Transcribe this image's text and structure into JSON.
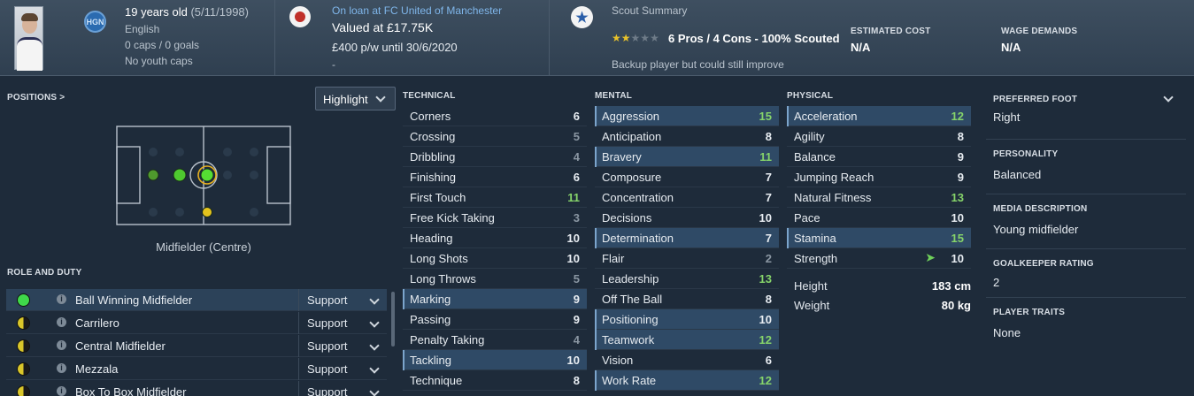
{
  "header": {
    "age": "19 years old",
    "dob": "(5/11/1998)",
    "nationality": "English",
    "caps": "0 caps / 0 goals",
    "youth_caps": "No youth caps",
    "badge_text": "HGN",
    "loan_text": "On loan at FC United of Manchester",
    "valued_at": "Valued at £17.75K",
    "contract": "£400 p/w until 30/6/2020",
    "contract_extra": "-",
    "scout_title": "Scout Summary",
    "scout_stars": 2,
    "scout_stars_max": 5,
    "scout_summary": "6 Pros / 4 Cons - 100% Scouted",
    "scout_note": "Backup player but could still improve",
    "estimated_cost_label": "ESTIMATED COST",
    "estimated_cost": "N/A",
    "wage_demands_label": "WAGE DEMANDS",
    "wage_demands": "N/A"
  },
  "positions": {
    "title": "POSITIONS >",
    "highlight_button": "Highlight",
    "position_label": "Midfielder (Centre)"
  },
  "roles": {
    "title": "ROLE AND DUTY",
    "items": [
      {
        "name": "Ball Winning Midfielder",
        "duty": "Support",
        "color": "#3fd84a"
      },
      {
        "name": "Carrilero",
        "duty": "Support",
        "color": "#d9c62a"
      },
      {
        "name": "Central Midfielder",
        "duty": "Support",
        "color": "#d9c62a"
      },
      {
        "name": "Mezzala",
        "duty": "Support",
        "color": "#d9c62a"
      },
      {
        "name": "Box To Box Midfielder",
        "duty": "Support",
        "color": "#d9c62a"
      }
    ]
  },
  "technical": {
    "title": "TECHNICAL",
    "items": [
      {
        "name": "Corners",
        "value": "6"
      },
      {
        "name": "Crossing",
        "value": "5"
      },
      {
        "name": "Dribbling",
        "value": "4"
      },
      {
        "name": "Finishing",
        "value": "6"
      },
      {
        "name": "First Touch",
        "value": "11"
      },
      {
        "name": "Free Kick Taking",
        "value": "3"
      },
      {
        "name": "Heading",
        "value": "10"
      },
      {
        "name": "Long Shots",
        "value": "10"
      },
      {
        "name": "Long Throws",
        "value": "5"
      },
      {
        "name": "Marking",
        "value": "9"
      },
      {
        "name": "Passing",
        "value": "9"
      },
      {
        "name": "Penalty Taking",
        "value": "4"
      },
      {
        "name": "Tackling",
        "value": "10"
      },
      {
        "name": "Technique",
        "value": "8"
      }
    ]
  },
  "mental": {
    "title": "MENTAL",
    "items": [
      {
        "name": "Aggression",
        "value": "15"
      },
      {
        "name": "Anticipation",
        "value": "8"
      },
      {
        "name": "Bravery",
        "value": "11"
      },
      {
        "name": "Composure",
        "value": "7"
      },
      {
        "name": "Concentration",
        "value": "7"
      },
      {
        "name": "Decisions",
        "value": "10"
      },
      {
        "name": "Determination",
        "value": "7"
      },
      {
        "name": "Flair",
        "value": "2"
      },
      {
        "name": "Leadership",
        "value": "13"
      },
      {
        "name": "Off The Ball",
        "value": "8"
      },
      {
        "name": "Positioning",
        "value": "10"
      },
      {
        "name": "Teamwork",
        "value": "12"
      },
      {
        "name": "Vision",
        "value": "6"
      },
      {
        "name": "Work Rate",
        "value": "12"
      }
    ]
  },
  "physical": {
    "title": "PHYSICAL",
    "items": [
      {
        "name": "Acceleration",
        "value": "12"
      },
      {
        "name": "Agility",
        "value": "8"
      },
      {
        "name": "Balance",
        "value": "9"
      },
      {
        "name": "Jumping Reach",
        "value": "9"
      },
      {
        "name": "Natural Fitness",
        "value": "13"
      },
      {
        "name": "Pace",
        "value": "10"
      },
      {
        "name": "Stamina",
        "value": "15"
      },
      {
        "name": "Strength",
        "value": "10"
      }
    ],
    "height_label": "Height",
    "height": "183 cm",
    "weight_label": "Weight",
    "weight": "80 kg"
  },
  "side": {
    "preferred_foot_label": "PREFERRED FOOT",
    "preferred_foot": "Right",
    "personality_label": "PERSONALITY",
    "personality": "Balanced",
    "media_label": "MEDIA DESCRIPTION",
    "media": "Young midfielder",
    "gk_rating_label": "GOALKEEPER RATING",
    "gk_rating": "2",
    "traits_label": "PLAYER TRAITS",
    "traits": "None"
  },
  "colors": {
    "low": "#8a96a2",
    "mid": "#e8edf2",
    "high": "#86d46a",
    "highlight_row": "#2f4a66"
  }
}
